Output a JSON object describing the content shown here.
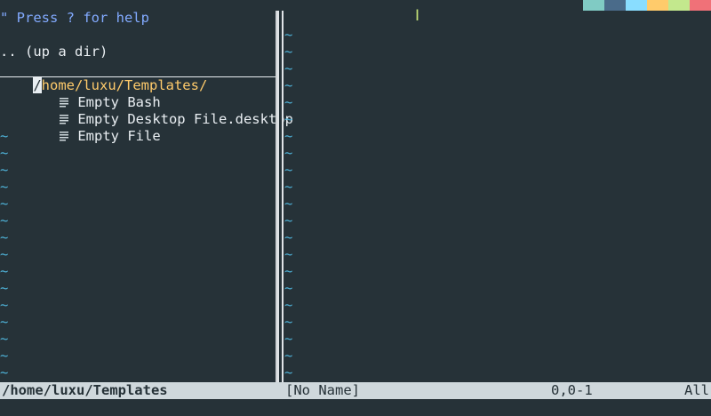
{
  "left_pane": {
    "help_line": "\" Press ? for help",
    "up_dir": ".. (up a dir)",
    "path_first": "/",
    "path_rest": "home/luxu/Templates/",
    "files": [
      {
        "icon": "document-icon",
        "name": "Empty Bash"
      },
      {
        "icon": "document-icon",
        "name": "Empty Desktop File.desktop"
      },
      {
        "icon": "document-icon",
        "name": "Empty File"
      }
    ],
    "tilde": "~"
  },
  "right_pane": {
    "tilde": "~"
  },
  "statusline": {
    "left_name": "/home/luxu/Templates",
    "right_name": "[No Name]",
    "position": "0,0-1",
    "percent": "All"
  },
  "theme": {
    "background": "#263238",
    "status_bg": "#cfd8dc",
    "tilde_color": "#4fb3d9",
    "path_color": "#ffcb6b",
    "help_color": "#82aaff",
    "swatches": [
      "#80cbc4",
      "#4a6b8a",
      "#89ddff",
      "#ffcb6b",
      "#c3e88d",
      "#f07178"
    ]
  }
}
